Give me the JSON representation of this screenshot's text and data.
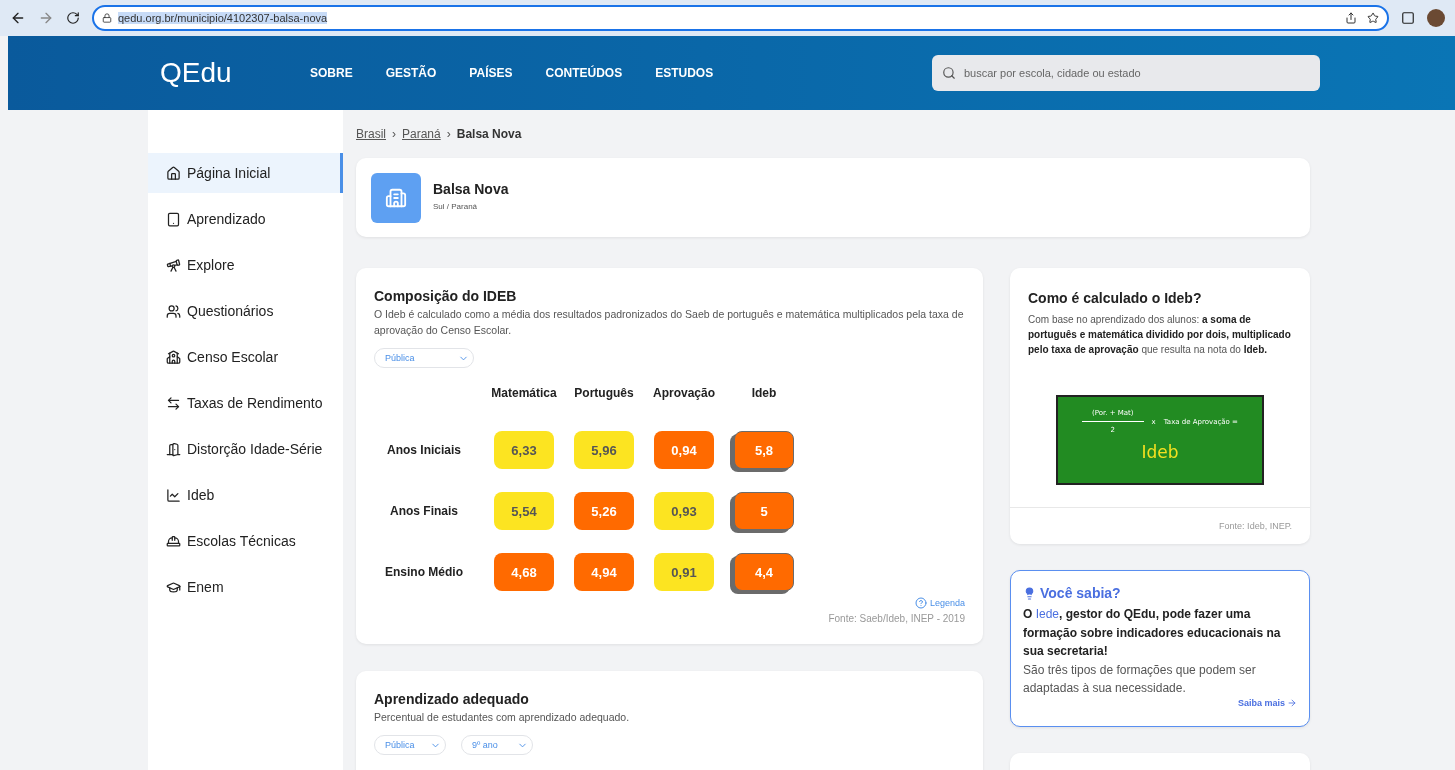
{
  "browser": {
    "url": "qedu.org.br/municipio/4102307-balsa-nova"
  },
  "header": {
    "logo": "QEdu",
    "nav": [
      "SOBRE",
      "GESTÃO",
      "PAÍSES",
      "CONTEÚDOS",
      "ESTUDOS"
    ],
    "search": {
      "placeholder": "buscar por escola, cidade ou estado"
    }
  },
  "sidebar": {
    "items": [
      {
        "label": "Página Inicial",
        "selected": true
      },
      {
        "label": "Aprendizado",
        "selected": false
      },
      {
        "label": "Explore",
        "selected": false
      },
      {
        "label": "Questionários",
        "selected": false
      },
      {
        "label": "Censo Escolar",
        "selected": false
      },
      {
        "label": "Taxas de Rendimento",
        "selected": false
      },
      {
        "label": "Distorção Idade-Série",
        "selected": false
      },
      {
        "label": "Ideb",
        "selected": false
      },
      {
        "label": "Escolas Técnicas",
        "selected": false
      },
      {
        "label": "Enem",
        "selected": false
      }
    ]
  },
  "breadcrumb": {
    "separator": "›",
    "items": [
      {
        "label": "Brasil",
        "current": false
      },
      {
        "label": "Paraná",
        "current": false
      },
      {
        "label": "Balsa Nova",
        "current": true
      }
    ]
  },
  "place": {
    "name": "Balsa Nova",
    "region": "Sul / Paraná"
  },
  "ideb_card": {
    "title": "Composição do IDEB",
    "description": "O Ideb é calculado como a média dos resultados padronizados do Saeb de português e matemática multiplicados pela taxa de aprovação do Censo Escolar.",
    "filter": "Pública",
    "columns": [
      {
        "label": "Matemática",
        "kind": "score"
      },
      {
        "label": "Português",
        "kind": "score"
      },
      {
        "label": "Aprovação",
        "kind": "score"
      },
      {
        "label": "Ideb",
        "kind": "ideb"
      }
    ],
    "rows": [
      {
        "label": "Anos Iniciais",
        "cells": [
          {
            "value": "6,33",
            "color": "#fce421"
          },
          {
            "value": "5,96",
            "color": "#fce421"
          },
          {
            "value": "0,94",
            "color": "#ff6a00"
          },
          {
            "value": "5,8",
            "color": "#ff6a00"
          }
        ]
      },
      {
        "label": "Anos Finais",
        "cells": [
          {
            "value": "5,54",
            "color": "#fce421"
          },
          {
            "value": "5,26",
            "color": "#ff6a00"
          },
          {
            "value": "0,93",
            "color": "#fce421"
          },
          {
            "value": "5",
            "color": "#ff6a00"
          }
        ]
      },
      {
        "label": "Ensino Médio",
        "cells": [
          {
            "value": "4,68",
            "color": "#ff6a00"
          },
          {
            "value": "4,94",
            "color": "#ff6a00"
          },
          {
            "value": "0,91",
            "color": "#fce421"
          },
          {
            "value": "4,4",
            "color": "#ff6a00"
          }
        ]
      }
    ],
    "legend": "Legenda",
    "source": "Fonte: Saeb/Ideb, INEP - 2019"
  },
  "calc_card": {
    "title": "Como é calculado o Ideb?",
    "text": "Com base no aprendizado dos alunos: **a soma de português e matemática dividido por dois, multiplicado pelo taxa de aprovação** que resulta na nota do **Ideb.**",
    "formula": {
      "numerator": "(Por. + Mat)",
      "denominator": "2",
      "times": "x",
      "rate": "Taxa de Aprovação =",
      "result": "Ideb"
    },
    "source": "Fonte: Ideb, INEP."
  },
  "tip_card": {
    "title": "Você sabia?",
    "before": "O ",
    "link": "Iede",
    "after": ", gestor do QEdu, pode fazer uma formação sobre indicadores educacionais na sua secretaria!",
    "text": "São três tipos de formações que podem ser adaptadas à sua necessidade.",
    "more": "Saiba mais"
  },
  "learning_card": {
    "title": "Aprendizado adequado",
    "description": "Percentual de estudantes com aprendizado adequado.",
    "filters": [
      "Pública",
      "9º ano"
    ]
  }
}
